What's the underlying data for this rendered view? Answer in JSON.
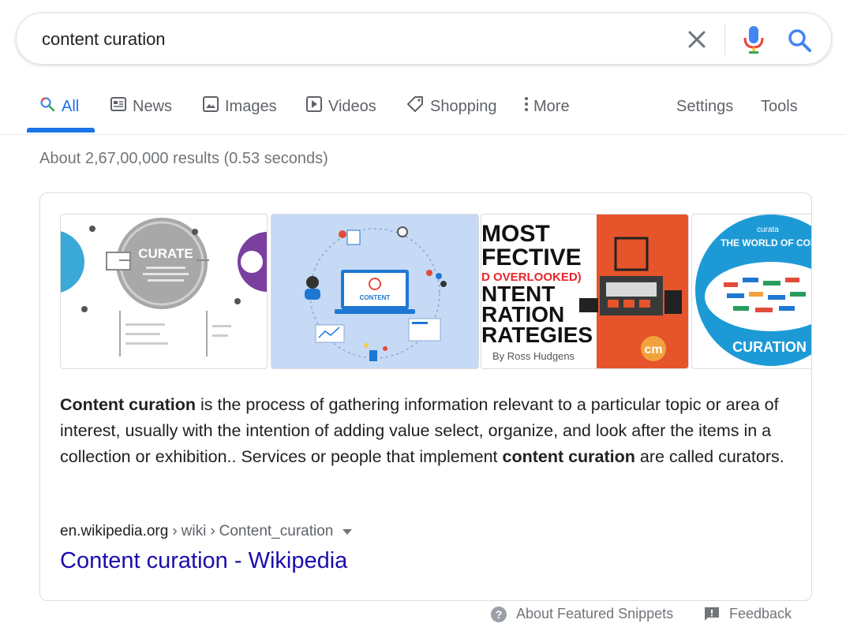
{
  "search": {
    "query": "content curation"
  },
  "tabs": [
    {
      "label": "All",
      "icon": "search-icon"
    },
    {
      "label": "News",
      "icon": "news-icon"
    },
    {
      "label": "Images",
      "icon": "image-icon"
    },
    {
      "label": "Videos",
      "icon": "play-icon"
    },
    {
      "label": "Shopping",
      "icon": "tag-icon"
    },
    {
      "label": "More",
      "icon": "more-vert-icon"
    }
  ],
  "tools": {
    "settings": "Settings",
    "tools": "Tools"
  },
  "stats": "About 2,67,00,000 results (0.53 seconds)",
  "images": {
    "img1": {
      "title": "CURATE"
    },
    "img2": {
      "title": "CONTENT"
    },
    "img3": {
      "lines": [
        "MOST",
        "FECTIVE",
        "D OVERLOOKED)",
        "NTENT",
        "RATION",
        "RATEGIES"
      ],
      "byline": "By Ross Hudgens",
      "logo": "cm"
    },
    "img4": {
      "brand": "curata",
      "headline": "THE WORLD OF CONTEN",
      "footer": "CURATION"
    }
  },
  "snippet": {
    "b1": "Content curation",
    "t1": " is the process of gathering information relevant to a particular topic or area of interest, usually with the intention of adding value select, organize, and look after the items in a collection or exhibition.. Services or people that implement ",
    "b2": "content curation",
    "t2": " are called curators."
  },
  "source": {
    "domain": "en.wikipedia.org",
    "path1": "wiki",
    "path2": "Content_curation",
    "title": "Content curation - Wikipedia"
  },
  "footer": {
    "about": "About Featured Snippets",
    "feedback": "Feedback"
  },
  "colors": {
    "link": "#1a0dab",
    "accent": "#1a73e8",
    "muted": "#70757a"
  }
}
